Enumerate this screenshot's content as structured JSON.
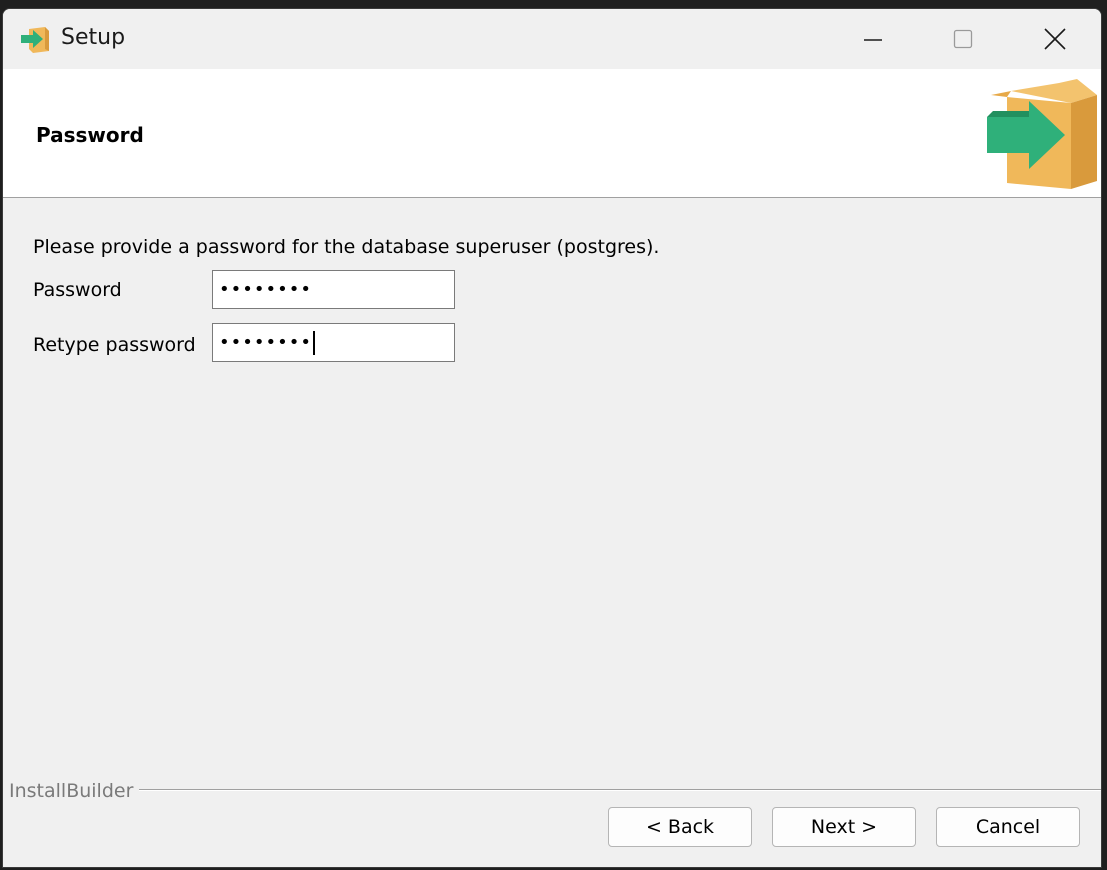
{
  "window": {
    "title": "Setup"
  },
  "header": {
    "title": "Password"
  },
  "body": {
    "instruction": "Please provide a password for the database superuser (postgres).",
    "password_label": "Password",
    "password_value": "••••••••",
    "retype_label": "Retype password",
    "retype_value": "••••••••"
  },
  "footer": {
    "brand": "InstallBuilder",
    "back_label": "< Back",
    "next_label": "Next >",
    "cancel_label": "Cancel"
  },
  "icons": {
    "app": "installer-box-arrow-icon",
    "minimize": "minimize-icon",
    "maximize": "maximize-icon",
    "close": "close-icon"
  },
  "colors": {
    "arrow_green": "#2fb07a",
    "box_yellow": "#f0b85a",
    "box_shadow": "#d99a3c"
  }
}
